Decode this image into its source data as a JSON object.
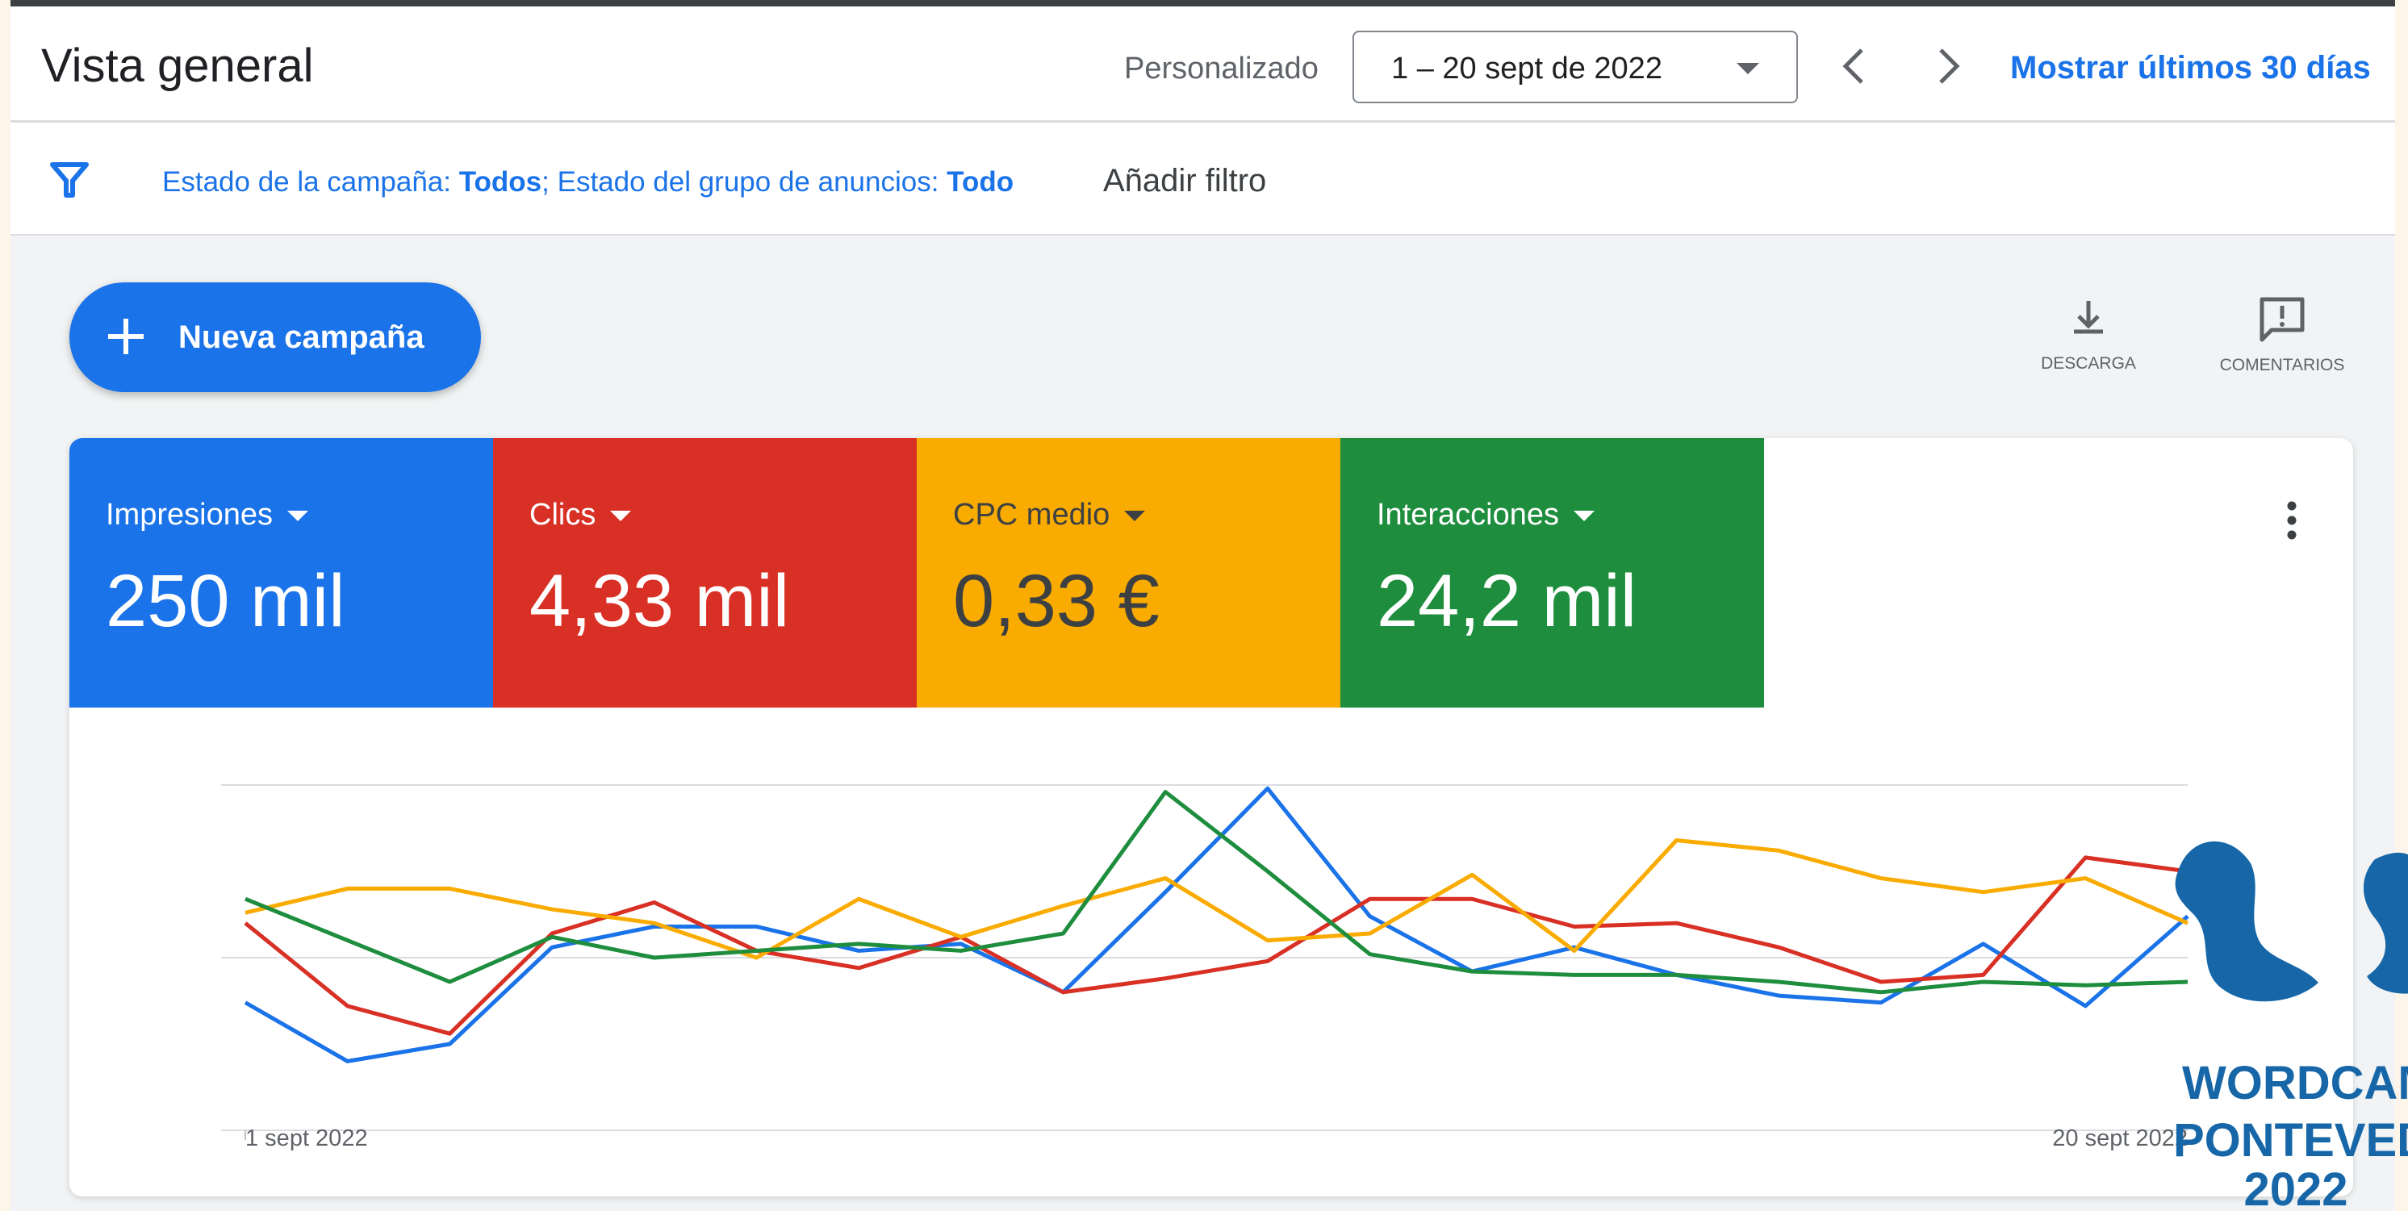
{
  "header": {
    "title": "Vista general",
    "range_label": "Personalizado",
    "date_range": "1 – 20 sept de 2022",
    "show_last": "Mostrar últimos 30 días"
  },
  "filters": {
    "campaign_label": "Estado de la campaña: ",
    "campaign_value": "Todos",
    "separator": "; ",
    "adgroup_label": "Estado del grupo de anuncios: ",
    "adgroup_value": "Todo",
    "add_filter": "Añadir filtro"
  },
  "toolbar": {
    "new_campaign": "Nueva campaña",
    "download": "DESCARGA",
    "comments": "COMENTARIOS"
  },
  "metrics": [
    {
      "name": "Impresiones",
      "value": "250 mil",
      "color": "#1a73e8"
    },
    {
      "name": "Clics",
      "value": "4,33 mil",
      "color": "#d93025"
    },
    {
      "name": "CPC medio",
      "value": "0,33 €",
      "color": "#f9ab00"
    },
    {
      "name": "Interacciones",
      "value": "24,2 mil",
      "color": "#1e8e3e"
    }
  ],
  "chart_data": {
    "type": "line",
    "x": [
      "1 sept 2022",
      "2",
      "3",
      "4",
      "5",
      "6",
      "7",
      "8",
      "9",
      "10",
      "11",
      "12",
      "13",
      "14",
      "15",
      "16",
      "17",
      "18",
      "19",
      "20 sept 2022"
    ],
    "x_tick_labels": [
      "1 sept 2022",
      "20 sept 2022"
    ],
    "ylim": [
      0,
      100
    ],
    "grid": true,
    "series": [
      {
        "color": "#1a73e8",
        "values": [
          37,
          20,
          25,
          53,
          59,
          59,
          52,
          54,
          40,
          69,
          99,
          62,
          46,
          53,
          45,
          39,
          37,
          54,
          36,
          62
        ]
      },
      {
        "color": "#d93025",
        "values": [
          60,
          36,
          28,
          57,
          66,
          52,
          47,
          56,
          40,
          44,
          49,
          67,
          67,
          59,
          60,
          53,
          43,
          45,
          79,
          75
        ]
      },
      {
        "color": "#f9ab00",
        "values": [
          63,
          70,
          70,
          64,
          60,
          50,
          67,
          56,
          65,
          73,
          55,
          57,
          74,
          52,
          84,
          81,
          73,
          69,
          73,
          60
        ]
      },
      {
        "color": "#1e8e3e",
        "values": [
          67,
          55,
          43,
          56,
          50,
          52,
          54,
          52,
          57,
          98,
          75,
          51,
          46,
          45,
          45,
          43,
          40,
          43,
          42,
          43
        ]
      }
    ]
  },
  "logo": {
    "line1": "WORDCAMP",
    "line2": "PONTEVEDRA",
    "line3": "2022",
    "color": "#1767a8"
  }
}
